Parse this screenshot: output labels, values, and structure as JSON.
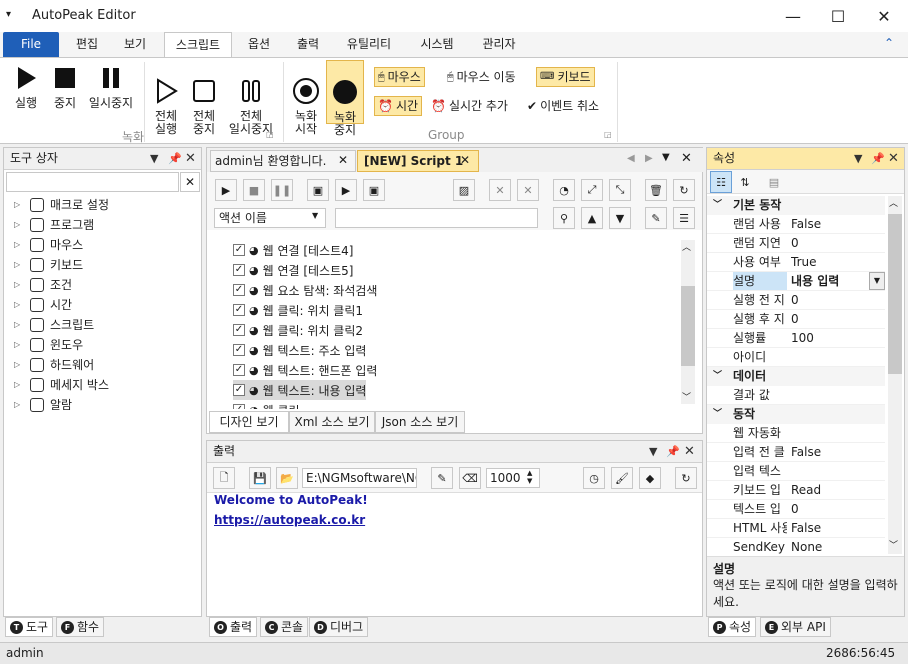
{
  "app": {
    "title": "AutoPeak Editor"
  },
  "window": {
    "minimize": "—",
    "maximize": "☐",
    "close": "✕"
  },
  "menu": {
    "items": [
      "File",
      "편집",
      "보기",
      "스크립트",
      "옵션",
      "출력",
      "유틸리티",
      "시스템",
      "관리자"
    ],
    "collapse": "⌃"
  },
  "ribbon": {
    "record_group": {
      "label": "녹화",
      "buttons": [
        "실행",
        "중지",
        "일시중지",
        "전체\n실행",
        "전체\n중지",
        "전체\n일시중지"
      ]
    },
    "group": {
      "label": "Group",
      "record_start": "녹화\n시작",
      "record_stop": "녹화\n중지",
      "mouse": "마우스",
      "mouse_move": "마우스 이동",
      "keyboard": "키보드",
      "time": "시간",
      "realtime_add": "실시간 추가",
      "event_cancel": "이벤트 취소"
    }
  },
  "toolbox": {
    "title": "도구 상자",
    "items": [
      "매크로 설정",
      "프로그램",
      "마우스",
      "키보드",
      "조건",
      "시간",
      "스크립트",
      "윈도우",
      "하드웨어",
      "메세지 박스",
      "알람"
    ],
    "tabs": [
      "도구",
      "함수"
    ],
    "tab_icons": [
      "T",
      "F"
    ]
  },
  "editor": {
    "tabs": [
      "admin님 환영합니다.",
      "[NEW] Script 1"
    ],
    "filter_select": "액션 이름",
    "actions": [
      "웹 연결 [테스트4]",
      "웹 연결 [테스트5]",
      "웹 요소 탐색: 좌석검색",
      "웹 클릭: 위치 클릭1",
      "웹 클릭: 위치 클릭2",
      "웹 텍스트: 주소 입력",
      "웹 텍스트: 핸드폰 입력",
      "웹 텍스트: 내용 입력",
      "웹 클릭"
    ],
    "view_tabs": [
      "디자인 보기",
      "Xml 소스 보기",
      "Json 소스 보기"
    ]
  },
  "output": {
    "title": "출력",
    "path": "E:\\NGMsoftware\\NG",
    "count": "1000",
    "welcome": "Welcome to AutoPeak!",
    "link": "https://autopeak.co.kr",
    "tabs": [
      "출력",
      "콘솔",
      "디버그"
    ],
    "tab_icons": [
      "O",
      "C",
      "D"
    ]
  },
  "properties": {
    "title": "속성",
    "categories": [
      {
        "name": "기본 동작",
        "rows": [
          [
            "랜덤 사용",
            "False"
          ],
          [
            "랜덤 지연",
            "0"
          ],
          [
            "사용 여부",
            "True"
          ],
          [
            "설명",
            "내용 입력"
          ],
          [
            "실행 전 지",
            "0"
          ],
          [
            "실행 후 지",
            "0"
          ],
          [
            "실행률",
            "100"
          ],
          [
            "아이디",
            ""
          ]
        ]
      },
      {
        "name": "데이터",
        "rows": [
          [
            "결과 값",
            ""
          ]
        ]
      },
      {
        "name": "동작",
        "rows": [
          [
            "웹 자동화",
            ""
          ],
          [
            "입력 전 클",
            "False"
          ],
          [
            "입력 텍스",
            ""
          ],
          [
            "키보드 입",
            "Read"
          ],
          [
            "텍스트 입",
            "0"
          ],
          [
            "HTML 사용",
            "False"
          ],
          [
            "SendKey 사",
            "None"
          ]
        ]
      }
    ],
    "desc_title": "설명",
    "desc_text": "액션 또는 로직에 대한 설명을 입력하세요.",
    "tabs": [
      "속성",
      "외부 API"
    ],
    "tab_icons": [
      "P",
      "E"
    ]
  },
  "status": {
    "user": "admin",
    "time": "2686:56:45"
  },
  "colors": {
    "accent": "#1f5fb8",
    "highlight": "#fde9a6",
    "selection": "#cce4f7"
  }
}
